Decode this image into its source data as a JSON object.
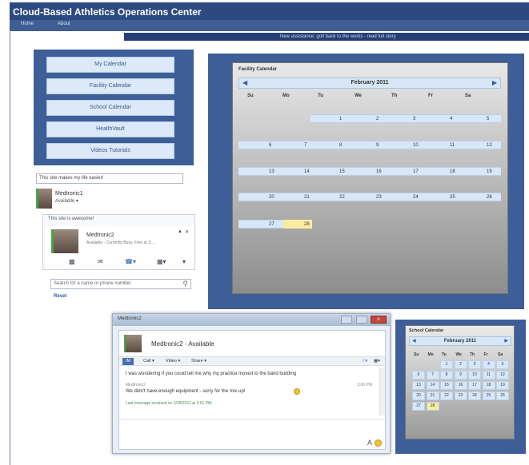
{
  "app": {
    "title": "Cloud-Based Athletics Operations Center"
  },
  "nav": {
    "tabs": [
      "Home",
      "About"
    ]
  },
  "ticker": {
    "text": "New assistance: golf back to the works - read full story"
  },
  "menu": {
    "items": [
      "My Calendar",
      "Facility Calendar",
      "School Calendar",
      "HealthVault",
      "Videos Tutorials"
    ]
  },
  "status_message": {
    "value": "This site makes my life easier!"
  },
  "presence": {
    "name": "Medtronic1",
    "status": "Available ▾"
  },
  "contact_card": {
    "heading": "This site is awesome!",
    "name": "Medtronic2",
    "detail": "Available · Currently Busy, Free at 3:..."
  },
  "search": {
    "placeholder": "Search for a name or phone number"
  },
  "reset_label": "Reset",
  "facility_calendar": {
    "title": "Facility Calendar",
    "month": "February 2011",
    "prev": "◀",
    "next": "▶",
    "days_of_week": [
      "Su",
      "Mo",
      "Tu",
      "We",
      "Th",
      "Fr",
      "Sa"
    ],
    "weeks": [
      [
        "",
        "",
        "1",
        "2",
        "3",
        "4",
        "5"
      ],
      [
        "6",
        "7",
        "8",
        "9",
        "10",
        "11",
        "12"
      ],
      [
        "13",
        "14",
        "15",
        "16",
        "17",
        "18",
        "19"
      ],
      [
        "20",
        "21",
        "22",
        "23",
        "24",
        "25",
        "26"
      ],
      [
        "27",
        "28",
        "",
        "",
        "",
        "",
        ""
      ]
    ],
    "highlight_day": "28"
  },
  "chat": {
    "window_title": "Medtronic2",
    "close_symbol": "x",
    "contact_status": "Medtronic2 - Available",
    "toolbar": [
      "IM",
      "Call ▾",
      "Video ▾",
      "Share ▾"
    ],
    "messages": [
      {
        "text": "I was wondering if you could tell me why my practice moved to the band building"
      },
      {
        "sender": "Medtronic2",
        "time": "3:00 PM",
        "text": "We didn't have enough equipment - sorry for the mix-up!"
      }
    ],
    "last_message": "Last message received on 2/28/2011 at 3:01 PM.",
    "font_symbol": "A"
  },
  "school_calendar": {
    "title": "School Calendar",
    "month": "February 2011",
    "days_of_week": [
      "Su",
      "Mo",
      "Tu",
      "We",
      "Th",
      "Fr",
      "Sa"
    ],
    "weeks": [
      [
        "",
        "",
        "1",
        "2",
        "3",
        "4",
        "5"
      ],
      [
        "6",
        "7",
        "8",
        "9",
        "10",
        "11",
        "12"
      ],
      [
        "13",
        "14",
        "15",
        "16",
        "17",
        "18",
        "19"
      ],
      [
        "20",
        "21",
        "22",
        "23",
        "24",
        "25",
        "26"
      ],
      [
        "27",
        "28",
        "",
        "",
        "",
        "",
        ""
      ]
    ],
    "highlight_day": "28"
  }
}
